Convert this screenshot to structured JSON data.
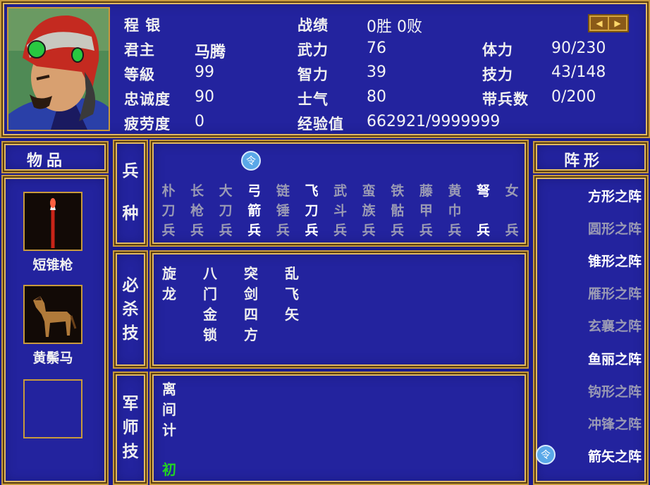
{
  "general": {
    "name": "程  银",
    "lord_label": "君主",
    "lord": "马腾",
    "level_label": "等級",
    "level": "99",
    "loyalty_label": "忠诚度",
    "loyalty": "90",
    "fatigue_label": "疲劳度",
    "fatigue": "0",
    "record_label": "战绩",
    "record": "0胜 0败",
    "force_label": "武力",
    "force": "76",
    "intel_label": "智力",
    "intel": "39",
    "morale_label": "士气",
    "morale": "80",
    "exp_label": "经验值",
    "exp": "662921/9999999",
    "hp_label": "体力",
    "hp": "90/230",
    "sp_label": "技力",
    "sp": "43/148",
    "troops_label": "带兵数",
    "troops": "0/200"
  },
  "arrow_icons": [
    "left-arrow-icon",
    "right-arrow-icon"
  ],
  "items": {
    "header": "物品",
    "list": [
      {
        "name": "短锥枪",
        "icon": "spear-icon"
      },
      {
        "name": "黄鬃马",
        "icon": "horse-icon"
      },
      {
        "name": "",
        "icon": ""
      }
    ]
  },
  "troop_types": {
    "label": "兵种",
    "badge": "令",
    "columns": [
      {
        "c1": "朴",
        "c2": "刀",
        "c3": "兵",
        "active": false
      },
      {
        "c1": "长",
        "c2": "枪",
        "c3": "兵",
        "active": false
      },
      {
        "c1": "大",
        "c2": "刀",
        "c3": "兵",
        "active": false
      },
      {
        "c1": "弓",
        "c2": "箭",
        "c3": "兵",
        "active": true
      },
      {
        "c1": "链",
        "c2": "锤",
        "c3": "兵",
        "active": false
      },
      {
        "c1": "飞",
        "c2": "刀",
        "c3": "兵",
        "active": true
      },
      {
        "c1": "武",
        "c2": "斗",
        "c3": "兵",
        "active": false
      },
      {
        "c1": "蛮",
        "c2": "族",
        "c3": "兵",
        "active": false
      },
      {
        "c1": "铁",
        "c2": "骷",
        "c3": "兵",
        "active": false
      },
      {
        "c1": "藤",
        "c2": "甲",
        "c3": "兵",
        "active": false
      },
      {
        "c1": "黄",
        "c2": "巾",
        "c3": "兵",
        "active": false
      },
      {
        "c1": "弩",
        "c2": "",
        "c3": "兵",
        "active": true
      },
      {
        "c1": "女",
        "c2": "",
        "c3": "兵",
        "active": false
      }
    ]
  },
  "special_skills": {
    "label": "必杀技",
    "columns": [
      [
        "旋",
        "龙"
      ],
      [
        "八",
        "门",
        "金",
        "锁"
      ],
      [
        "突",
        "剑",
        "四",
        "方"
      ],
      [
        "乱",
        "飞",
        "矢"
      ]
    ]
  },
  "strategist_skills": {
    "label": "军师技",
    "skill": [
      "离",
      "间",
      "计"
    ],
    "rank": "初",
    "rank_color": "#22d422"
  },
  "formations": {
    "header": "阵形",
    "list": [
      {
        "name": "方形之阵",
        "available": true
      },
      {
        "name": "圆形之阵",
        "available": false
      },
      {
        "name": "锥形之阵",
        "available": true
      },
      {
        "name": "雁形之阵",
        "available": false
      },
      {
        "name": "玄襄之阵",
        "available": false
      },
      {
        "name": "鱼丽之阵",
        "available": true
      },
      {
        "name": "钩形之阵",
        "available": false
      },
      {
        "name": "冲锋之阵",
        "available": false
      },
      {
        "name": "箭矢之阵",
        "available": true,
        "selected": true
      }
    ],
    "selected_badge": "令"
  },
  "colors": {
    "panel_bg": "#23239e",
    "border_gold": "#c89a3c",
    "active_text": "#ffffff",
    "inactive_text": "#9a9ab4"
  }
}
